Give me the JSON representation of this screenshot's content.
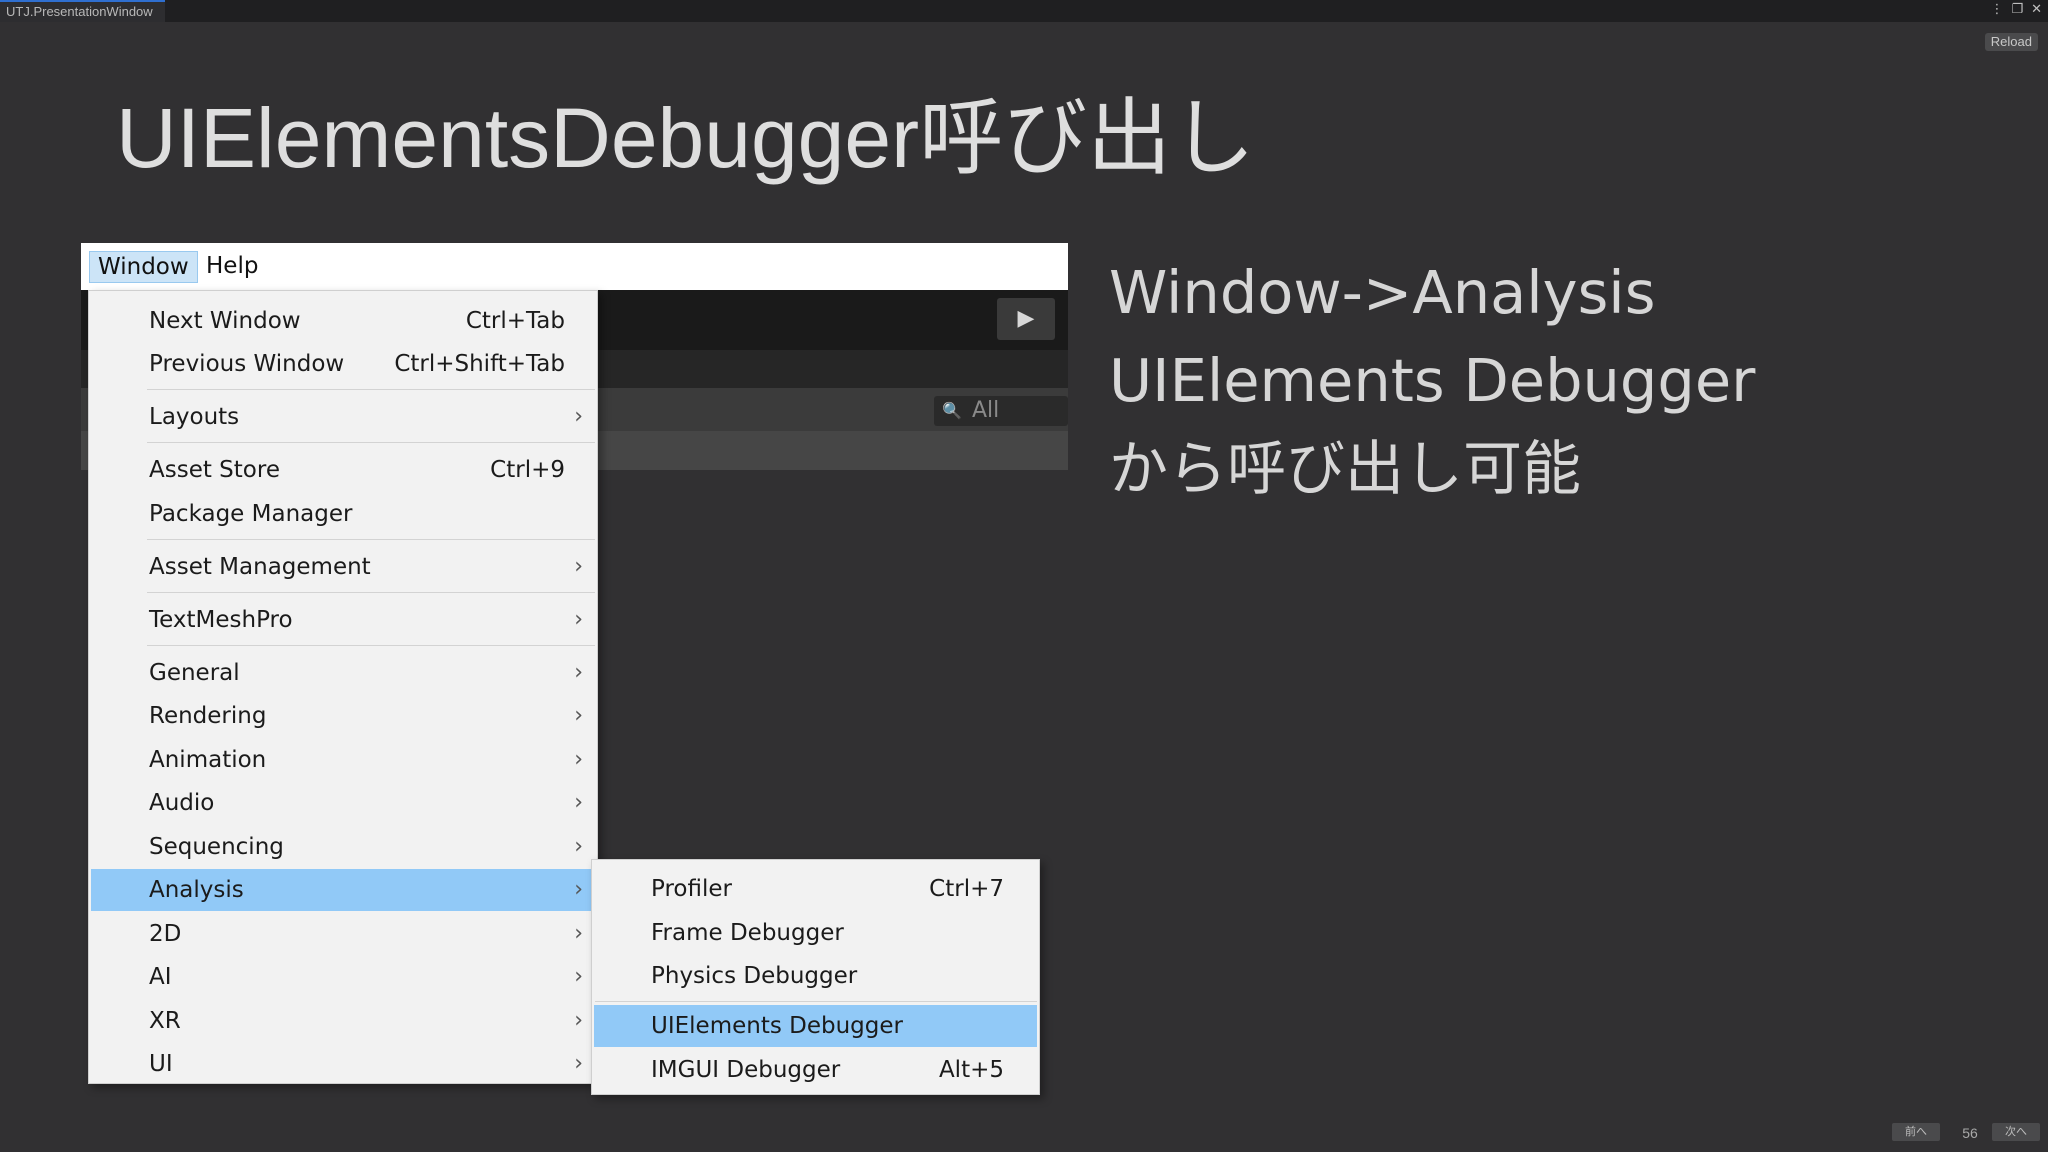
{
  "window": {
    "tab_title": "UTJ.PresentationWindow",
    "kebab_icon": "⋮",
    "maximize_icon": "❐",
    "close_icon": "✕"
  },
  "toolbar": {
    "reload_label": "Reload"
  },
  "slide": {
    "title": "UIElementsDebugger呼び出し",
    "description_lines": [
      "Window->Analysis",
      "UIElements Debugger",
      "から呼び出し可能"
    ]
  },
  "editor": {
    "play_icon": "▶",
    "search_icon": "🔍",
    "search_value": "All"
  },
  "menubar": {
    "items": [
      "Window",
      "Help"
    ]
  },
  "window_menu": {
    "items": [
      {
        "label": "Next Window",
        "shortcut": "Ctrl+Tab",
        "arrow": ""
      },
      {
        "label": "Previous Window",
        "shortcut": "Ctrl+Shift+Tab",
        "arrow": ""
      },
      {
        "label": "Layouts",
        "shortcut": "",
        "arrow": "›"
      },
      {
        "label": "Asset Store",
        "shortcut": "Ctrl+9",
        "arrow": ""
      },
      {
        "label": "Package Manager",
        "shortcut": "",
        "arrow": ""
      },
      {
        "label": "Asset Management",
        "shortcut": "",
        "arrow": "›"
      },
      {
        "label": "TextMeshPro",
        "shortcut": "",
        "arrow": "›"
      },
      {
        "label": "General",
        "shortcut": "",
        "arrow": "›"
      },
      {
        "label": "Rendering",
        "shortcut": "",
        "arrow": "›"
      },
      {
        "label": "Animation",
        "shortcut": "",
        "arrow": "›"
      },
      {
        "label": "Audio",
        "shortcut": "",
        "arrow": "›"
      },
      {
        "label": "Sequencing",
        "shortcut": "",
        "arrow": "›"
      },
      {
        "label": "Analysis",
        "shortcut": "",
        "arrow": "›"
      },
      {
        "label": "2D",
        "shortcut": "",
        "arrow": "›"
      },
      {
        "label": "AI",
        "shortcut": "",
        "arrow": "›"
      },
      {
        "label": "XR",
        "shortcut": "",
        "arrow": "›"
      },
      {
        "label": "UI",
        "shortcut": "",
        "arrow": "›"
      }
    ]
  },
  "analysis_submenu": {
    "items": [
      {
        "label": "Profiler",
        "shortcut": "Ctrl+7"
      },
      {
        "label": "Frame Debugger",
        "shortcut": ""
      },
      {
        "label": "Physics Debugger",
        "shortcut": ""
      },
      {
        "label": "UIElements Debugger",
        "shortcut": ""
      },
      {
        "label": "IMGUI Debugger",
        "shortcut": "Alt+5"
      }
    ]
  },
  "footer": {
    "prev_label": "前へ",
    "page_number": "56",
    "next_label": "次へ"
  }
}
